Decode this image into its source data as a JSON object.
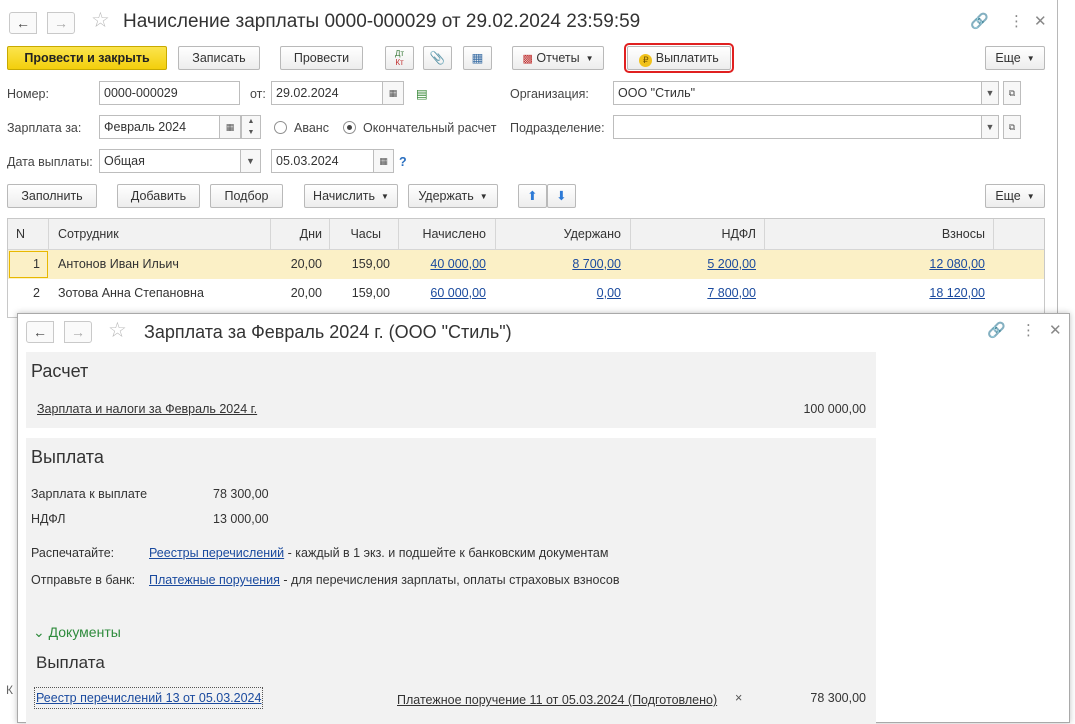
{
  "doc": {
    "title": "Начисление зарплаты 0000-000029 от 29.02.2024 23:59:59",
    "toolbar": {
      "post_close": "Провести и закрыть",
      "save": "Записать",
      "post": "Провести",
      "dtkt_top": "Дт",
      "dtkt_bottom": "Кт",
      "reports": "Отчеты",
      "pay": "Выплатить",
      "more": "Еще"
    },
    "fields": {
      "number_label": "Номер:",
      "number_value": "0000-000029",
      "date_label": "от:",
      "date_value": "29.02.2024",
      "org_label": "Организация:",
      "org_value": "ООО \"Стиль\"",
      "salary_for_label": "Зарплата за:",
      "salary_for_value": "Февраль 2024",
      "advance_label": "Аванс",
      "final_label": "Окончательный расчет",
      "dept_label": "Подразделение:",
      "dept_value": "",
      "pay_date_label": "Дата выплаты:",
      "pay_date_kind": "Общая",
      "pay_date_value": "05.03.2024",
      "help": "?"
    },
    "table_toolbar": {
      "fill": "Заполнить",
      "add": "Добавить",
      "pick": "Подбор",
      "accrue": "Начислить",
      "withhold": "Удержать",
      "more": "Еще"
    },
    "table": {
      "columns": [
        "N",
        "Сотрудник",
        "Дни",
        "Часы",
        "Начислено",
        "Удержано",
        "НДФЛ",
        "Взносы"
      ],
      "rows": [
        {
          "n": "1",
          "employee": "Антонов Иван Ильич",
          "days": "20,00",
          "hours": "159,00",
          "accrued": "40 000,00",
          "withheld": "8 700,00",
          "ndfl": "5 200,00",
          "contrib": "12 080,00"
        },
        {
          "n": "2",
          "employee": "Зотова Анна Степановна",
          "days": "20,00",
          "hours": "159,00",
          "accrued": "60 000,00",
          "withheld": "0,00",
          "ndfl": "7 800,00",
          "contrib": "18 120,00"
        }
      ]
    },
    "stub_text": "К"
  },
  "popup": {
    "title": "Зарплата за Февраль 2024 г. (ООО \"Стиль\")",
    "calc": {
      "heading": "Расчет",
      "link": "Зарплата и налоги за Февраль 2024 г.",
      "amount": "100 000,00"
    },
    "payout": {
      "heading": "Выплата",
      "salary_label": "Зарплата к выплате",
      "salary_value": "78 300,00",
      "ndfl_label": "НДФЛ",
      "ndfl_value": "13 000,00",
      "print_label": "Распечатайте:",
      "print_link": "Реестры перечислений",
      "print_rest": " - каждый в 1 экз. и подшейте к банковским документам",
      "bank_label": "Отправьте в банк:",
      "bank_link": "Платежные поручения",
      "bank_rest": " - для перечисления зарплаты, оплаты страховых взносов"
    },
    "documents": {
      "toggle": "Документы",
      "heading": "Выплата",
      "registry_link": "Реестр перечислений 13 от 05.03.2024",
      "order_link": "Платежное поручение 11 от 05.03.2024 (Подготовлено)",
      "remove": "×",
      "amount": "78 300,00"
    }
  },
  "icons": {
    "back": "arrow-left-icon",
    "forward": "arrow-right-icon",
    "star": "star-icon",
    "link": "link-icon",
    "more": "vertical-dots-icon",
    "close": "close-icon"
  },
  "colors": {
    "primary_button": "#f3cf0c",
    "pay_highlight": "#e02020",
    "link": "#1a4a9e",
    "selected_row": "#fbf0c6",
    "documents_green": "#2e8b3c"
  }
}
